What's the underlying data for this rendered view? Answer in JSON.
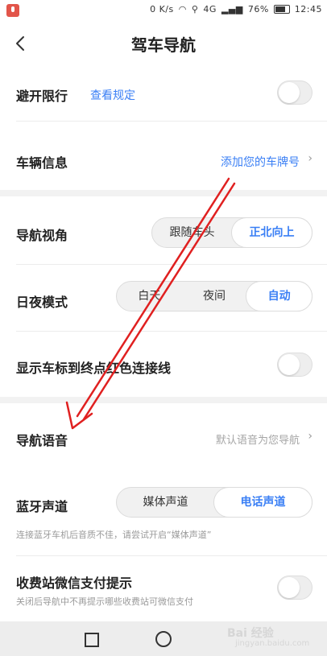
{
  "status_bar": {
    "speed": "0 K/s",
    "battery": "76%",
    "time": "12:45",
    "network": "4G"
  },
  "header": {
    "title": "驾车导航"
  },
  "rows": {
    "avoid_limit": {
      "label": "避开限行",
      "link": "查看规定",
      "toggle_on": false
    },
    "vehicle_info": {
      "label": "车辆信息",
      "value": "添加您的车牌号"
    },
    "nav_view": {
      "label": "导航视角",
      "options": [
        "跟随车头",
        "正北向上"
      ],
      "selected": "正北向上"
    },
    "day_night": {
      "label": "日夜模式",
      "options": [
        "白天",
        "夜间",
        "自动"
      ],
      "selected": "自动"
    },
    "show_line": {
      "label": "显示车标到终点红色连接线",
      "toggle_on": false
    },
    "nav_voice": {
      "label": "导航语音",
      "value": "默认语音为您导航"
    },
    "bt_channel": {
      "label": "蓝牙声道",
      "options": [
        "媒体声道",
        "电话声道"
      ],
      "selected": "电话声道",
      "hint": "连接蓝牙车机后音质不佳，请尝试开启“媒体声道”"
    },
    "toll_pay": {
      "label": "收费站微信支付提示",
      "hint": "关闭后导航中不再提示哪些收费站可微信支付",
      "toggle_on": false
    }
  },
  "watermark": {
    "brand": "Bai 经验",
    "url": "jingyan.baidu.com"
  },
  "colors": {
    "accent": "#3a7ff5",
    "annotation_arrow": "#e02020"
  }
}
